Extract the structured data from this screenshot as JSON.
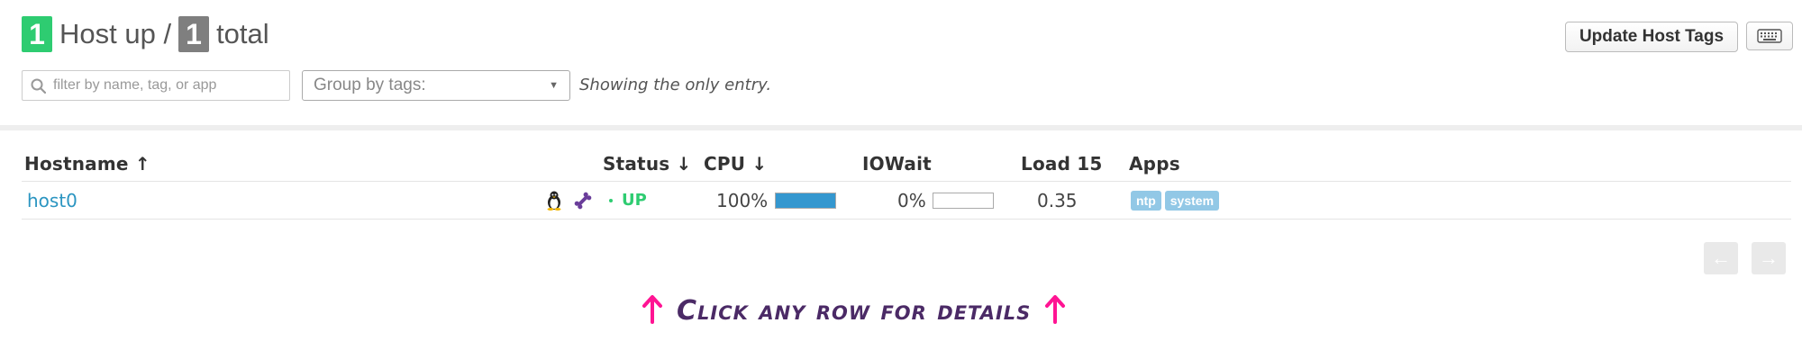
{
  "header": {
    "up_count": "1",
    "up_label": "Host up /",
    "total_count": "1",
    "total_label": "total"
  },
  "search": {
    "placeholder": "filter by name, tag, or app",
    "value": ""
  },
  "group_by": {
    "label": "Group by tags:"
  },
  "showing_text": "Showing the only entry.",
  "buttons": {
    "update_host_tags": "Update Host Tags",
    "keyboard_icon": "keyboard-icon"
  },
  "table": {
    "columns": {
      "hostname": "Hostname ↑",
      "status": "Status ↓",
      "cpu": "CPU ↓",
      "iowait": "IOWait",
      "load15": "Load 15",
      "apps": "Apps"
    },
    "rows": [
      {
        "hostname": "host0",
        "os_icon": "linux-tux-icon",
        "agent_icon": "bone-icon",
        "status": "UP",
        "cpu": "100%",
        "cpu_fraction": 1.0,
        "iowait": "0%",
        "iowait_fraction": 0.0,
        "load15": "0.35",
        "apps": [
          "ntp",
          "system"
        ]
      }
    ]
  },
  "pager": {
    "prev": "←",
    "next": "→"
  },
  "hint": {
    "text": "Click any row for details",
    "arrow": "↑"
  },
  "colors": {
    "up_badge": "#2ecc71",
    "total_badge": "#7f7f7f",
    "link": "#2b95c1",
    "status_up": "#2ecc71",
    "bar_fill": "#3497cf",
    "app_tag": "#92c8e6",
    "hint_text": "#4b2a66",
    "hint_arrow": "#ff1493"
  }
}
